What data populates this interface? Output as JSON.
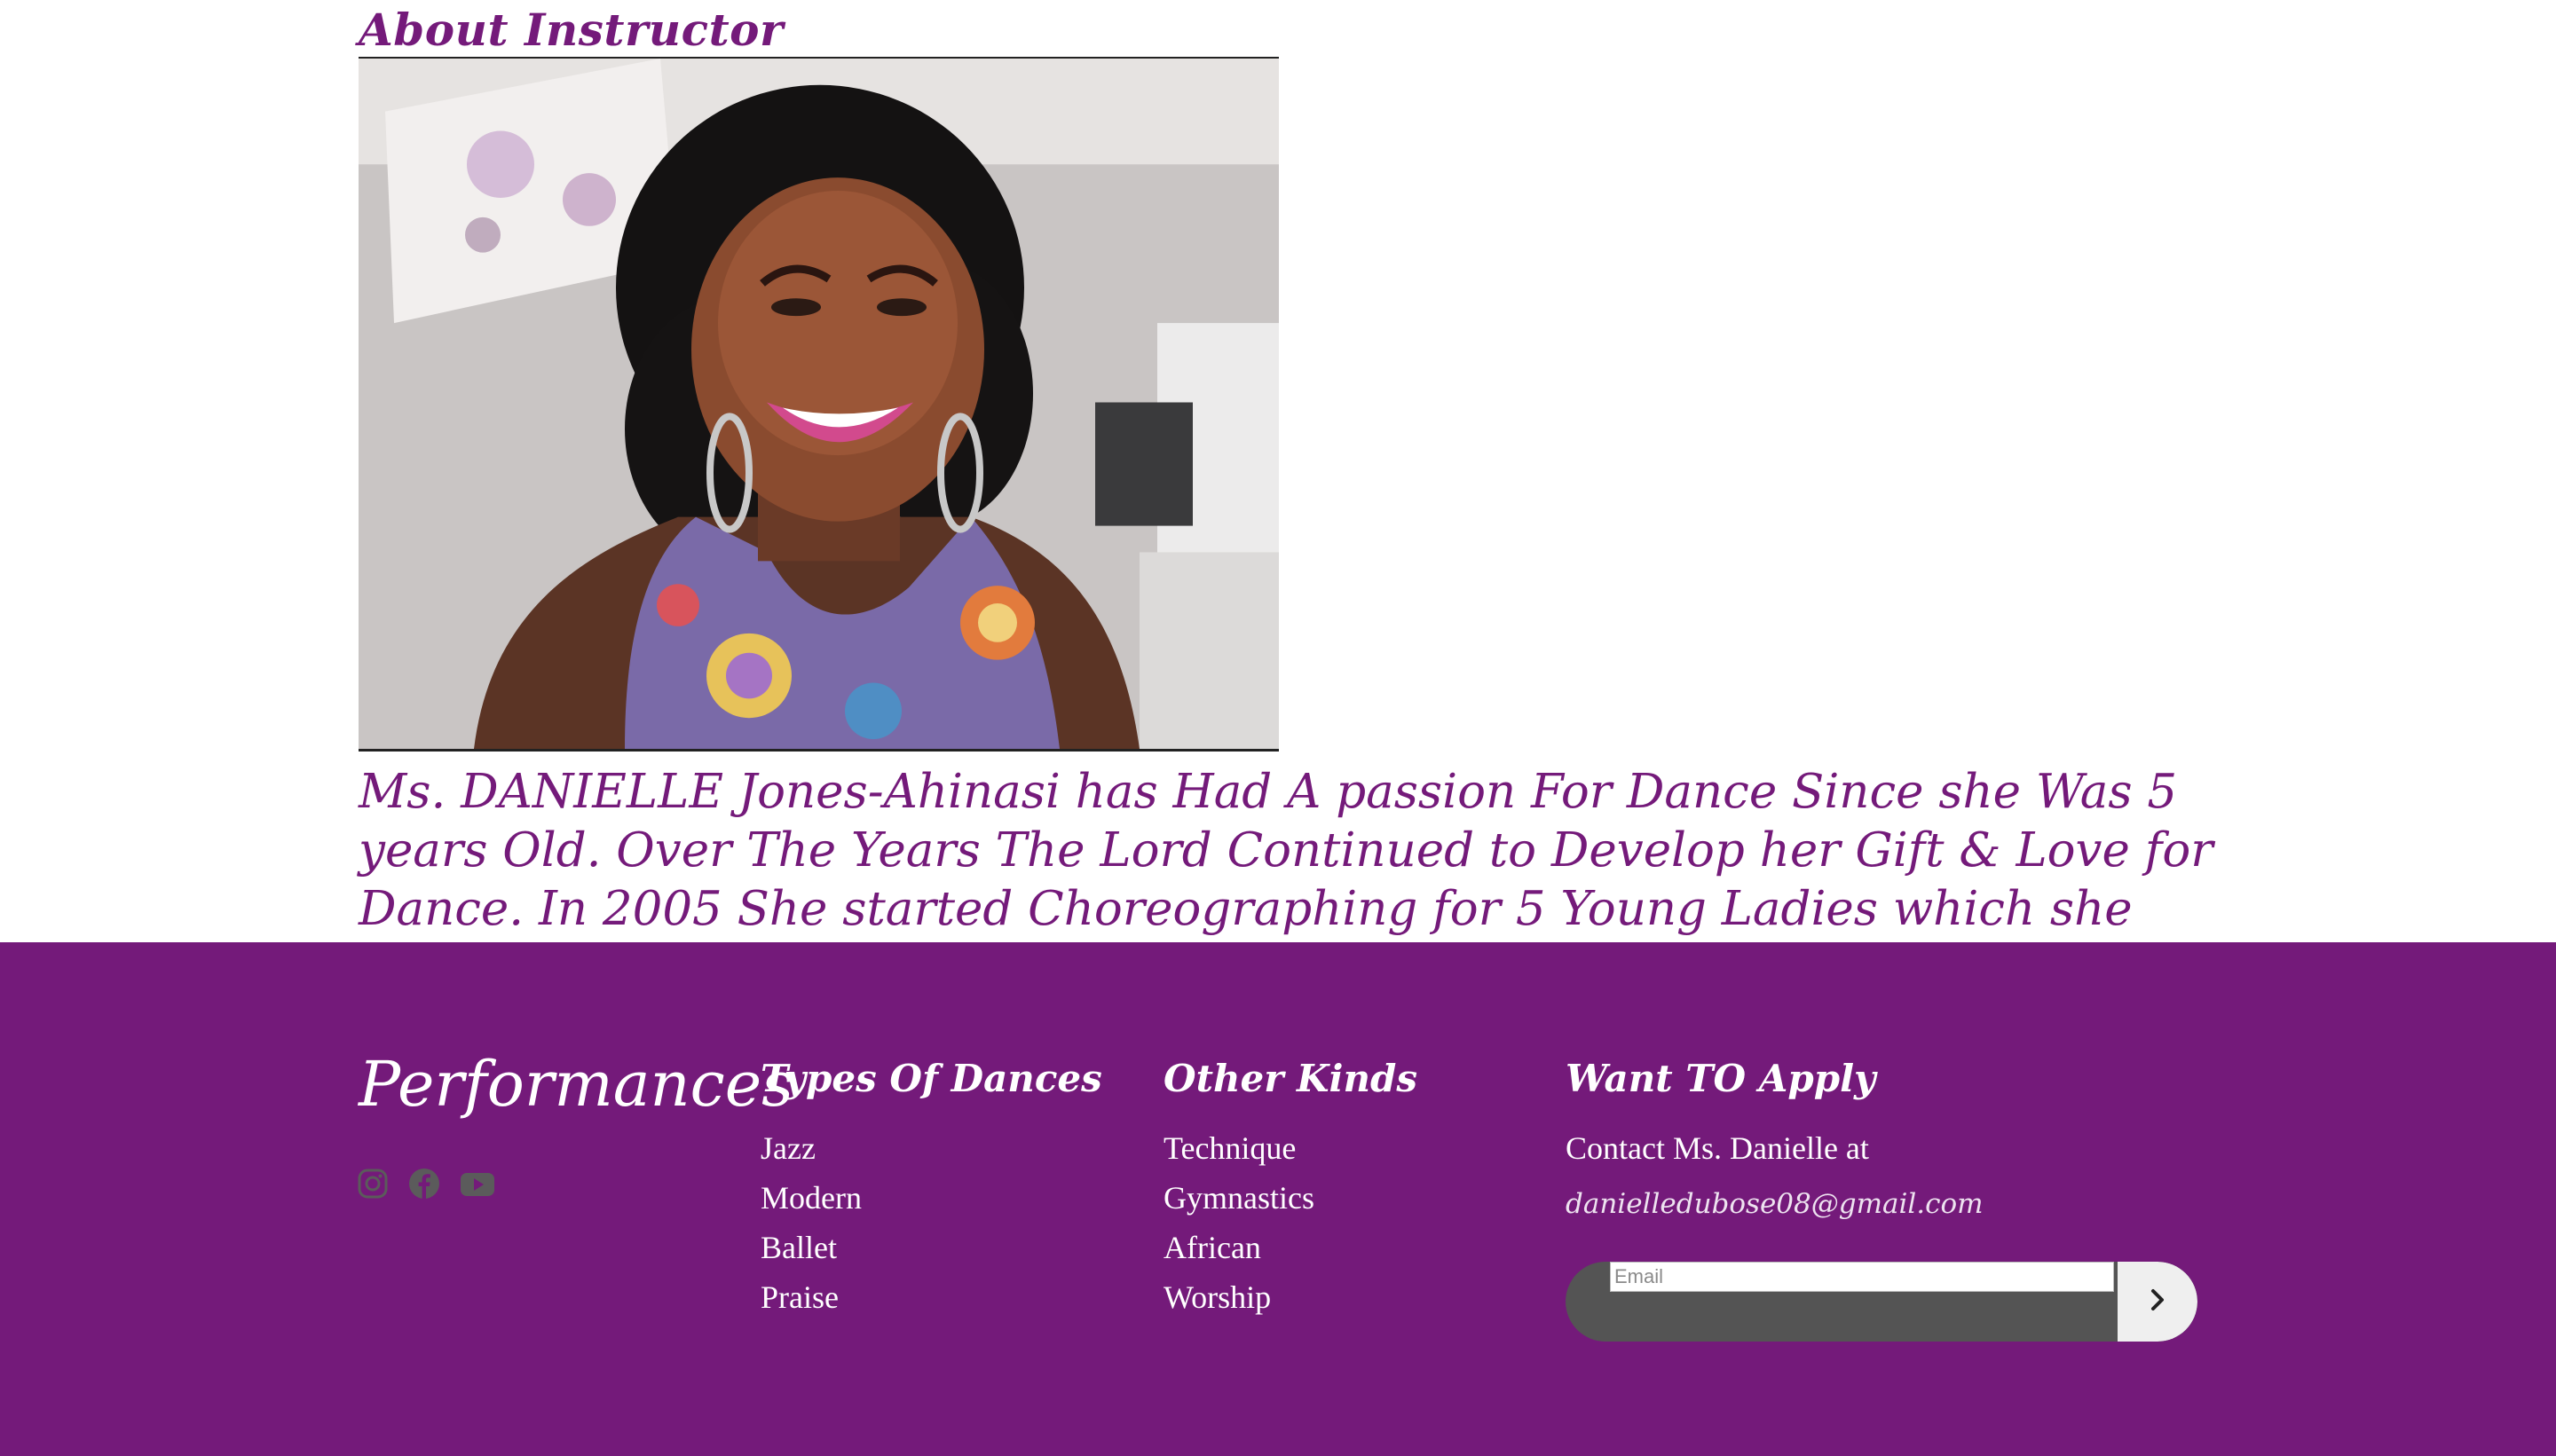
{
  "about": {
    "heading": "About Instructor",
    "bio": "Ms. DANIELLE Jones-Ahinasi has Had A passion For Dance Since she Was 5 years Old. Over The Years The Lord Continued to Develop her Gift & Love for Dance. In 2005 She started Choreographing for 5 Young Ladies which she Called Them \"GROWING IN GRACE\"."
  },
  "footer": {
    "brand": "Performances",
    "social": [
      "instagram-icon",
      "facebook-icon",
      "youtube-icon"
    ],
    "columns": [
      {
        "title": "Types Of Dances",
        "items": [
          "Jazz",
          "Modern",
          "Ballet",
          "Praise"
        ]
      },
      {
        "title": "Other Kinds",
        "items": [
          "Technique",
          "Gymnastics",
          "African",
          "Worship"
        ]
      }
    ],
    "apply": {
      "title": "Want TO Apply",
      "contact": "Contact Ms. Danielle at",
      "email": "danielledubose08@gmail.com",
      "input_placeholder": "Email"
    }
  },
  "colors": {
    "brand_purple": "#741a7a",
    "social_icon": "#5b5b5b",
    "subscribe_bar": "#545454"
  }
}
